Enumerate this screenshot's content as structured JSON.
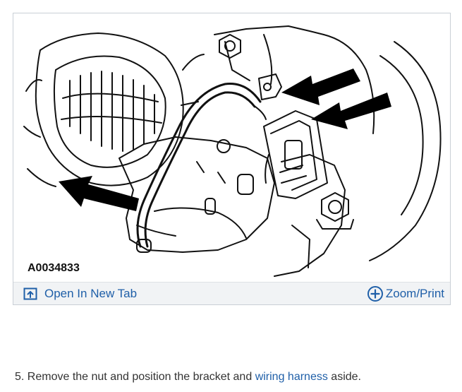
{
  "figure": {
    "id_label": "A0034833",
    "open_label": "Open In New Tab",
    "zoom_label": "Zoom/Print",
    "link_color": "#1f5fa8",
    "icons": {
      "open": "open-new-tab-icon",
      "zoom": "zoom-plus-icon"
    }
  },
  "step": {
    "number": "5.",
    "text_before": "Remove the nut and position the bracket and",
    "link_text": "wiring harness",
    "text_after": "aside."
  }
}
